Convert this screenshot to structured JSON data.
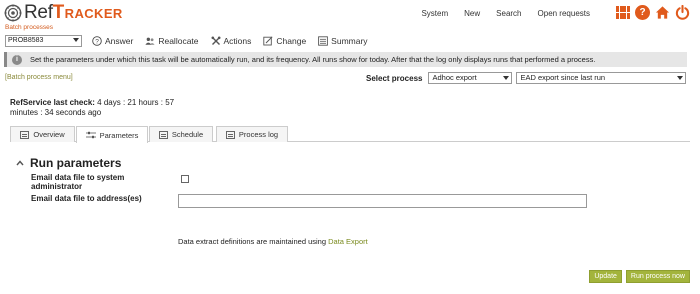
{
  "app": {
    "logo_ref": "Ref",
    "logo_tracker": "Tracker"
  },
  "topnav": {
    "items": [
      "System",
      "New",
      "Search",
      "Open requests"
    ]
  },
  "icons": {
    "apps": "apps-grid-icon",
    "help": "help-icon",
    "home": "home-icon",
    "power": "power-icon"
  },
  "colors": {
    "accent": "#e05a1c",
    "button": "#a3b43c",
    "link": "#7a8a1e"
  },
  "batch": {
    "label": "Batch processes",
    "selected": "PROB8583"
  },
  "toolbar": {
    "answer": "Answer",
    "reallocate": "Reallocate",
    "actions": "Actions",
    "change": "Change",
    "summary": "Summary"
  },
  "info": {
    "text": "Set the parameters under which this task will be automatically run, and its frequency. All runs show for today. After that the log only displays runs that performed a process."
  },
  "menu": {
    "link": "[Batch process menu]"
  },
  "select_process": {
    "label": "Select process",
    "value1": "Adhoc export",
    "value2": "EAD export since last run"
  },
  "lastcheck": {
    "label": "RefService last check:",
    "value_line1": "4 days : 21 hours : 57",
    "value_line2": "minutes : 34 seconds ago"
  },
  "tabs": [
    {
      "label": "Overview"
    },
    {
      "label": "Parameters"
    },
    {
      "label": "Schedule"
    },
    {
      "label": "Process log"
    }
  ],
  "run_params": {
    "title": "Run parameters",
    "email_admin_line1": "Email data file to system",
    "email_admin_line2": "administrator",
    "email_address": "Email data file to address(es)",
    "email_address_value": ""
  },
  "footnote": {
    "text": "Data extract definitions are maintained using",
    "link": "Data Export"
  },
  "buttons": {
    "update": "Update",
    "run_now": "Run process now"
  }
}
